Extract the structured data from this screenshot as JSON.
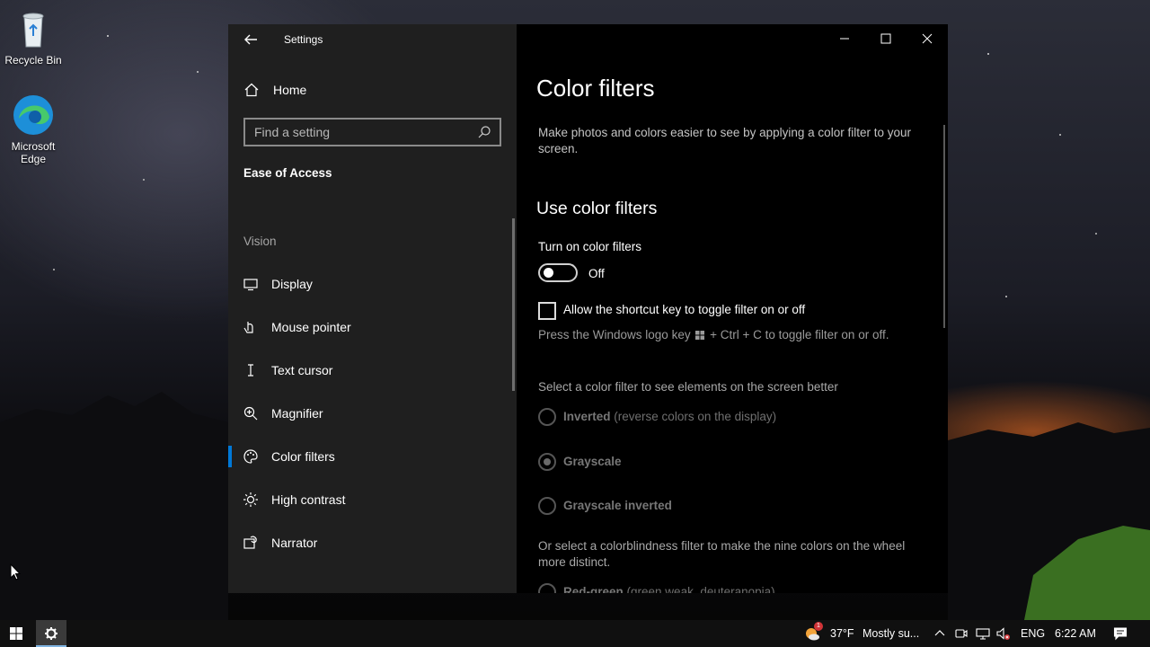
{
  "desktop": {
    "icons": [
      {
        "label": "Recycle Bin"
      },
      {
        "label": "Microsoft Edge"
      }
    ]
  },
  "window": {
    "title": "Settings",
    "sidebar": {
      "home_label": "Home",
      "search_placeholder": "Find a setting",
      "section_title": "Ease of Access",
      "group_label": "Vision",
      "items": [
        {
          "label": "Display",
          "icon": "monitor-icon"
        },
        {
          "label": "Mouse pointer",
          "icon": "pointer-icon"
        },
        {
          "label": "Text cursor",
          "icon": "text-cursor-icon"
        },
        {
          "label": "Magnifier",
          "icon": "magnifier-icon"
        },
        {
          "label": "Color filters",
          "icon": "palette-icon",
          "active": true
        },
        {
          "label": "High contrast",
          "icon": "contrast-icon"
        },
        {
          "label": "Narrator",
          "icon": "narrator-icon"
        }
      ]
    },
    "content": {
      "page_title": "Color filters",
      "description": "Make photos and colors easier to see by applying a color filter to your screen.",
      "subtitle": "Use color filters",
      "toggle_label": "Turn on color filters",
      "toggle_state": "Off",
      "toggle_on": false,
      "checkbox_label": "Allow the shortcut key to toggle filter on or off",
      "checkbox_checked": false,
      "shortcut_hint_prefix": "Press the Windows logo key",
      "shortcut_hint_suffix": "+ Ctrl + C to toggle filter on or off.",
      "select_label": "Select a color filter to see elements on the screen better",
      "filters": [
        {
          "name": "Inverted",
          "detail": "(reverse colors on the display)",
          "checked": false
        },
        {
          "name": "Grayscale",
          "detail": "",
          "checked": true
        },
        {
          "name": "Grayscale inverted",
          "detail": "",
          "checked": false
        },
        {
          "name": "Red-green",
          "detail": "(green weak, deuteranopia)",
          "checked": false
        }
      ],
      "colorblind_label": "Or select a colorblindness filter to make the nine colors on the wheel more distinct."
    }
  },
  "taskbar": {
    "weather_badge": "1",
    "temperature": "37°F",
    "weather_text": "Mostly su...",
    "language": "ENG",
    "time": "6:22 AM"
  },
  "colors": {
    "accent": "#0078d7",
    "sidebar_bg": "#1f1f1f",
    "content_bg": "#000000"
  }
}
